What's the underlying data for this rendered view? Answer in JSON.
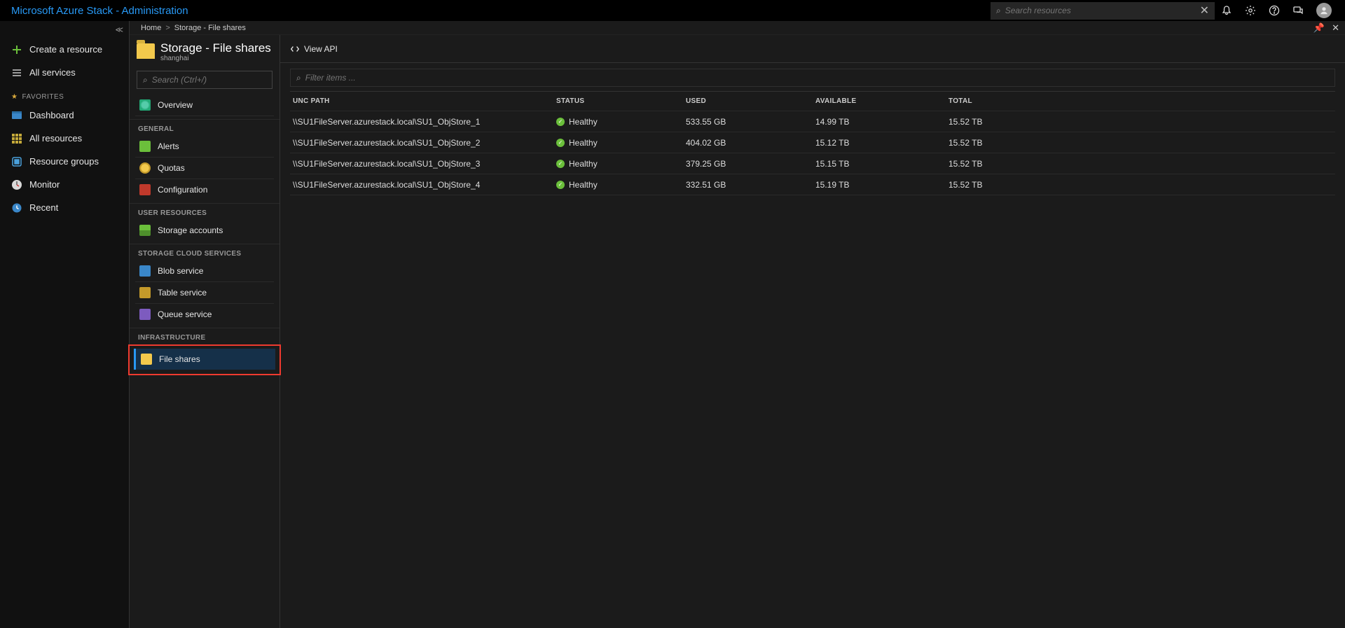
{
  "topbar": {
    "title": "Microsoft Azure Stack - Administration",
    "search_placeholder": "Search resources",
    "clear_label": "✕"
  },
  "nav": {
    "create": "Create a resource",
    "all_services": "All services",
    "favorites_header": "FAVORITES",
    "items": [
      "Dashboard",
      "All resources",
      "Resource groups",
      "Monitor",
      "Recent"
    ]
  },
  "breadcrumb": {
    "home": "Home",
    "current": "Storage - File shares"
  },
  "res_header": {
    "title": "Storage - File shares",
    "subtitle": "shanghai",
    "search_placeholder": "Search (Ctrl+/)"
  },
  "res_menu": {
    "overview": "Overview",
    "general_header": "GENERAL",
    "alerts": "Alerts",
    "quotas": "Quotas",
    "configuration": "Configuration",
    "user_header": "USER RESOURCES",
    "storage_accounts": "Storage accounts",
    "cloud_header": "STORAGE CLOUD SERVICES",
    "blob": "Blob service",
    "table": "Table service",
    "queue": "Queue service",
    "infra_header": "INFRASTRUCTURE",
    "file_shares": "File shares"
  },
  "content": {
    "view_api": "View API",
    "filter_placeholder": "Filter items ...",
    "headers": {
      "unc": "UNC PATH",
      "status": "STATUS",
      "used": "USED",
      "available": "AVAILABLE",
      "total": "TOTAL"
    },
    "rows": [
      {
        "unc": "\\\\SU1FileServer.azurestack.local\\SU1_ObjStore_1",
        "status": "Healthy",
        "used": "533.55 GB",
        "available": "14.99 TB",
        "total": "15.52 TB"
      },
      {
        "unc": "\\\\SU1FileServer.azurestack.local\\SU1_ObjStore_2",
        "status": "Healthy",
        "used": "404.02 GB",
        "available": "15.12 TB",
        "total": "15.52 TB"
      },
      {
        "unc": "\\\\SU1FileServer.azurestack.local\\SU1_ObjStore_3",
        "status": "Healthy",
        "used": "379.25 GB",
        "available": "15.15 TB",
        "total": "15.52 TB"
      },
      {
        "unc": "\\\\SU1FileServer.azurestack.local\\SU1_ObjStore_4",
        "status": "Healthy",
        "used": "332.51 GB",
        "available": "15.19 TB",
        "total": "15.52 TB"
      }
    ]
  }
}
